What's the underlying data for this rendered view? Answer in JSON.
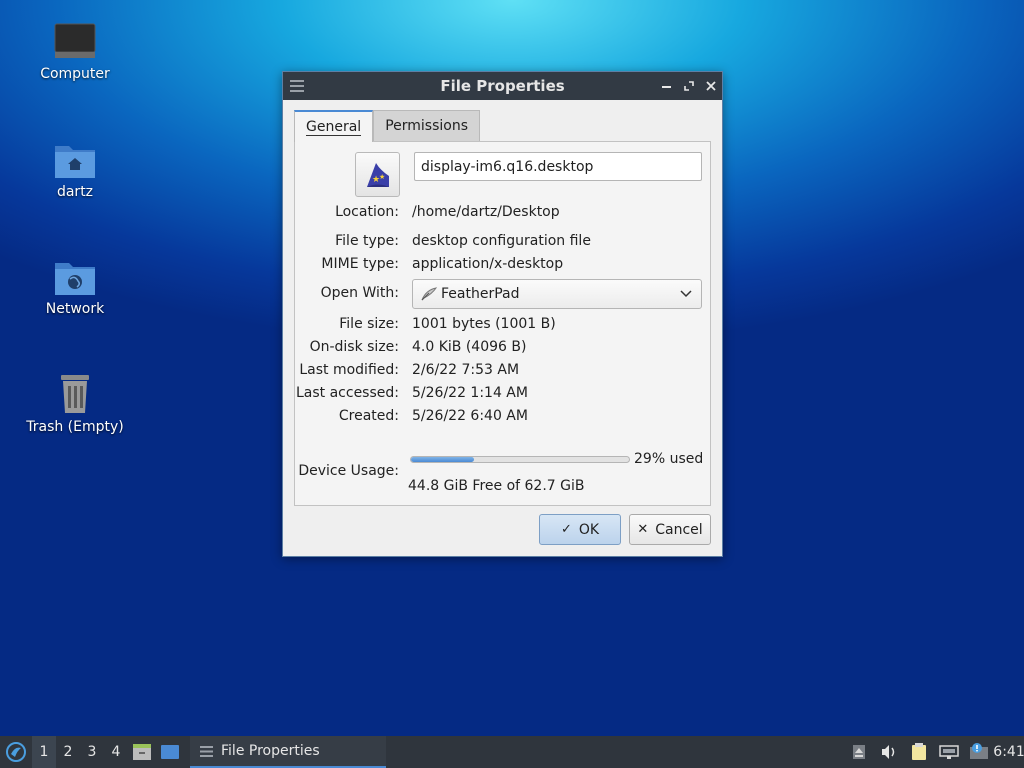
{
  "desktop": {
    "icons": [
      {
        "label": "Computer",
        "icon": "computer-icon"
      },
      {
        "label": "dartz",
        "icon": "home-folder-icon"
      },
      {
        "label": "Network",
        "icon": "network-folder-icon"
      },
      {
        "label": "Trash (Empty)",
        "icon": "trash-icon"
      }
    ]
  },
  "dialog": {
    "title": "File Properties",
    "tabs": [
      {
        "label": "General",
        "active": true
      },
      {
        "label": "Permissions",
        "active": false
      }
    ],
    "file_icon": "wizard-hat-icon",
    "filename": "display-im6.q16.desktop",
    "fields": {
      "location": {
        "label": "Location:",
        "value": "/home/dartz/Desktop"
      },
      "file_type": {
        "label": "File type:",
        "value": "desktop configuration file"
      },
      "mime_type": {
        "label": "MIME type:",
        "value": "application/x-desktop"
      },
      "open_with": {
        "label": "Open With:",
        "value": "FeatherPad"
      },
      "file_size": {
        "label": "File size:",
        "value": "1001 bytes (1001 B)"
      },
      "on_disk_size": {
        "label": "On-disk size:",
        "value": "4.0 KiB (4096 B)"
      },
      "last_modified": {
        "label": "Last modified:",
        "value": "2/6/22 7:53 AM"
      },
      "last_accessed": {
        "label": "Last accessed:",
        "value": "5/26/22 1:14 AM"
      },
      "created": {
        "label": "Created:",
        "value": "5/26/22 6:40 AM"
      }
    },
    "device_usage": {
      "label": "Device Usage:",
      "used_fraction": 0.29,
      "used_text": "29% used",
      "free_text": "44.8 GiB Free of 62.7 GiB"
    },
    "buttons": {
      "ok": "OK",
      "cancel": "Cancel"
    }
  },
  "taskbar": {
    "workspaces": [
      "1",
      "2",
      "3",
      "4"
    ],
    "active_workspace": "1",
    "task_label": "File Properties",
    "clock": "6:41"
  },
  "colors": {
    "accent": "#4a8ad4",
    "titlebar": "#323a44",
    "taskbar": "#2f353d"
  }
}
